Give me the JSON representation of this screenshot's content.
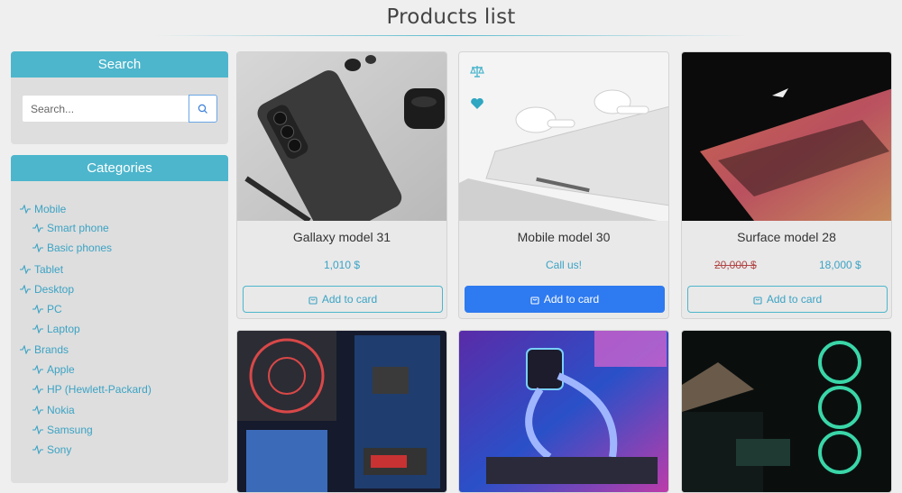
{
  "header": {
    "title": "Products list"
  },
  "sidebar": {
    "search": {
      "heading": "Search",
      "placeholder": "Search..."
    },
    "categories": {
      "heading": "Categories",
      "items": [
        {
          "label": "Mobile",
          "level": 0
        },
        {
          "label": "Smart phone",
          "level": 1
        },
        {
          "label": "Basic phones",
          "level": 1
        },
        {
          "label": "Tablet",
          "level": 0
        },
        {
          "label": "Desktop",
          "level": 0
        },
        {
          "label": "PC",
          "level": 1
        },
        {
          "label": "Laptop",
          "level": 1
        },
        {
          "label": "Brands",
          "level": 0
        },
        {
          "label": "Apple",
          "level": 1
        },
        {
          "label": "HP (Hewlett-Packard)",
          "level": 1
        },
        {
          "label": "Nokia",
          "level": 1
        },
        {
          "label": "Samsung",
          "level": 1
        },
        {
          "label": "Sony",
          "level": 1
        }
      ]
    }
  },
  "products": [
    {
      "name": "Gallaxy model 31",
      "price": "1,010 $",
      "old_price": "",
      "button": "Add to card",
      "image": "black phone and earbuds"
    },
    {
      "name": "Mobile model 30",
      "price": "Call us!",
      "old_price": "",
      "button": "Add to card",
      "image": "white earbuds on laptop",
      "button_active": true,
      "icons": [
        "compare-icon",
        "heart-icon"
      ]
    },
    {
      "name": "Surface model 28",
      "price": "18,000 $",
      "old_price": "20,000 $",
      "button": "Add to card",
      "image": "laptop keyboard backlit"
    },
    {
      "name": "",
      "image": "pc internals red fan"
    },
    {
      "name": "",
      "image": "rgb water cooled pc"
    },
    {
      "name": "",
      "image": "green fans pc case"
    }
  ],
  "colors": {
    "accent": "#4db6cc",
    "link": "#3ba3c4",
    "primary_button": "#2e7af0",
    "old_price": "#b14848"
  }
}
